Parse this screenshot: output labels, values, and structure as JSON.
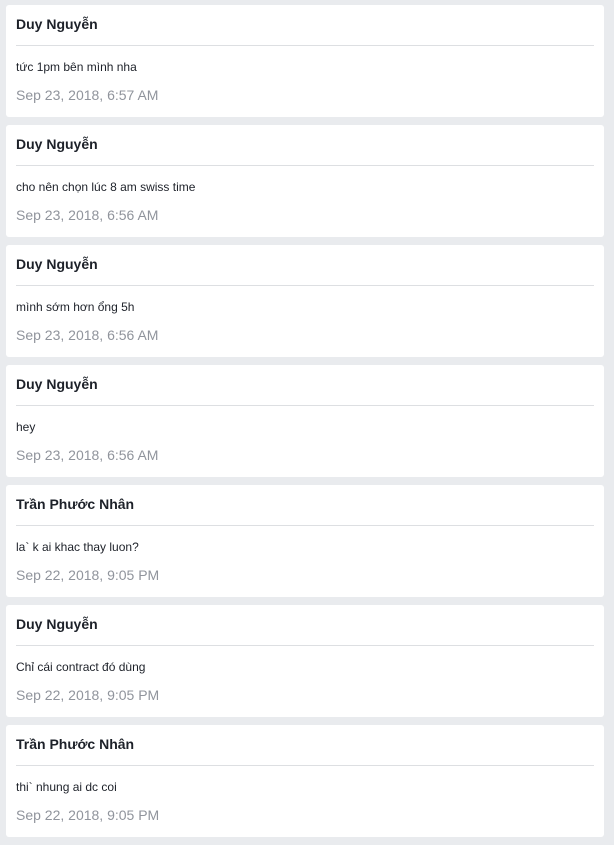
{
  "messages": [
    {
      "sender": "Duy Nguyễn",
      "text": "tức 1pm bên mình nha",
      "time": "Sep 23, 2018, 6:57 AM"
    },
    {
      "sender": "Duy Nguyễn",
      "text": "cho nên chọn lúc 8 am swiss time",
      "time": "Sep 23, 2018, 6:56 AM"
    },
    {
      "sender": "Duy Nguyễn",
      "text": "mình sớm hơn ổng 5h",
      "time": "Sep 23, 2018, 6:56 AM"
    },
    {
      "sender": "Duy Nguyễn",
      "text": "hey",
      "time": "Sep 23, 2018, 6:56 AM"
    },
    {
      "sender": "Trần Phước Nhân",
      "text": "la` k ai khac thay luon?",
      "time": "Sep 22, 2018, 9:05 PM"
    },
    {
      "sender": "Duy Nguyễn",
      "text": "Chỉ cái contract đó dùng",
      "time": "Sep 22, 2018, 9:05 PM"
    },
    {
      "sender": "Trần Phước Nhân",
      "text": "thi` nhung ai dc coi",
      "time": "Sep 22, 2018, 9:05 PM"
    }
  ]
}
